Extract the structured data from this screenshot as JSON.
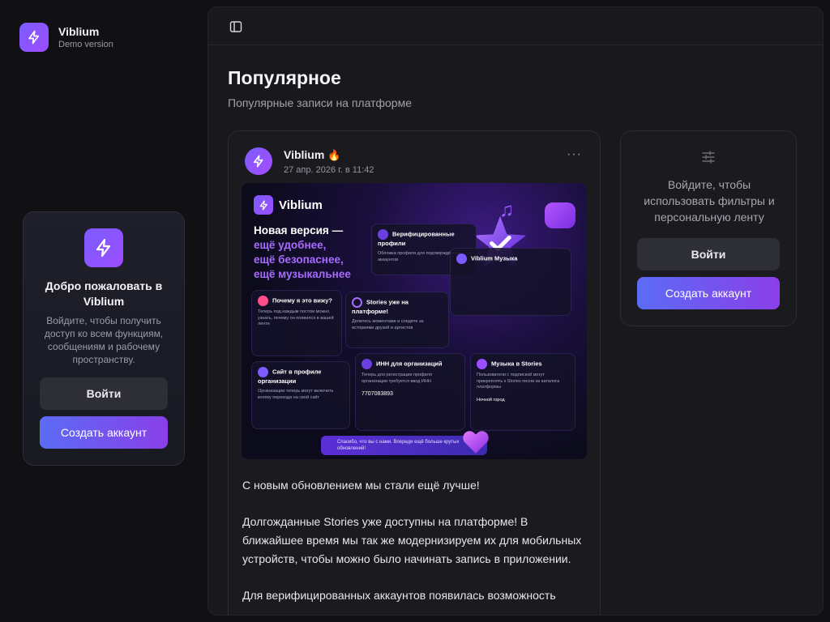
{
  "brand": {
    "name": "Viblium",
    "subtitle": "Demo version"
  },
  "welcome": {
    "title": "Добро пожаловать в Viblium",
    "text": "Войдите, чтобы получить доступ ко всем функциям, сообщениям и рабочему пространству.",
    "login_label": "Войти",
    "signup_label": "Создать аккаунт"
  },
  "page": {
    "title": "Популярное",
    "subtitle": "Популярные записи на платформе"
  },
  "post": {
    "author": "Viblium",
    "badge": "🔥",
    "date": "27 апр. 2026 г. в 11:42",
    "more": "···",
    "paragraphs": [
      "С новым обновлением мы стали ещё лучше!",
      "Долгожданные Stories уже доступны на платформе! В ближайшее время мы так же модернизируем их для мобильных устройств, чтобы можно было начинать запись в приложении.",
      "Для верифицированных аккаунтов появилась возможность"
    ],
    "media": {
      "brand": "Viblium",
      "headline": [
        "Новая версия —",
        "ещё удобнее,",
        "ещё безопаснее,",
        "ещё музыкальнее"
      ],
      "cards": {
        "verified": {
          "title": "Верифицированные профили",
          "desc": "Обложка профиля для подтверждённых аккаунтов"
        },
        "why": {
          "title": "Почему я это вижу?",
          "desc": "Теперь под каждым постом можно узнать, почему он появился в вашей ленте"
        },
        "stories": {
          "title": "Stories уже на платформе!",
          "desc": "Делитесь моментами и следите за историями друзей и артистов"
        },
        "site": {
          "title": "Сайт в профиле организации",
          "desc": "Организации теперь могут включить кнопку перехода на свой сайт"
        },
        "inn": {
          "title": "ИНН для организаций",
          "desc": "Теперь для регистрации профиля организации требуется ввод ИНН",
          "value": "7707083893"
        },
        "music": {
          "title": "Музыка в Stories",
          "desc": "Пользователи с подпиской могут прикреплять к Stories песни из каталога платформы",
          "track": "Ночной город"
        }
      },
      "footer": "Спасибо, что вы с нами. Впереди ещё больше крутых обновлений!"
    }
  },
  "filters": {
    "text": "Войдите, чтобы использовать фильтры и персональную ленту",
    "login_label": "Войти",
    "signup_label": "Создать аккаунт"
  },
  "colors": {
    "accent": "#8a3fe8",
    "accent_start": "#5b6cf5",
    "background": "#111113",
    "panel": "#19191c"
  },
  "icons": {
    "brand": "lightning-icon",
    "sidebar_toggle": "sidebar-toggle-icon",
    "filters": "sliders-icon"
  }
}
